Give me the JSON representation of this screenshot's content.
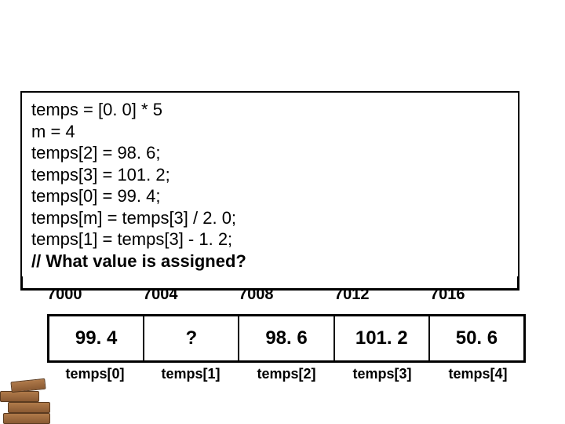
{
  "code": {
    "l1": "temps = [0. 0] * 5",
    "l2": "m = 4",
    "l3": "temps[2] = 98. 6;",
    "l4": "temps[3] = 101. 2;",
    "l5": "temps[0] = 99. 4;",
    "l6": "temps[m] = temps[3] / 2. 0;",
    "l7": "temps[1] = temps[3] - 1. 2;",
    "l8": "// What value is assigned?"
  },
  "addresses": {
    "a0": "7000",
    "a1": "7004",
    "a2": "7008",
    "a3": "7012",
    "a4": "7016"
  },
  "values": {
    "v0": "99. 4",
    "v1": "?",
    "v2": "98. 6",
    "v3": "101. 2",
    "v4": "50. 6"
  },
  "labels": {
    "t0": "temps[0]",
    "t1": "temps[1]",
    "t2": "temps[2]",
    "t3": "temps[3]",
    "t4": "temps[4]"
  }
}
